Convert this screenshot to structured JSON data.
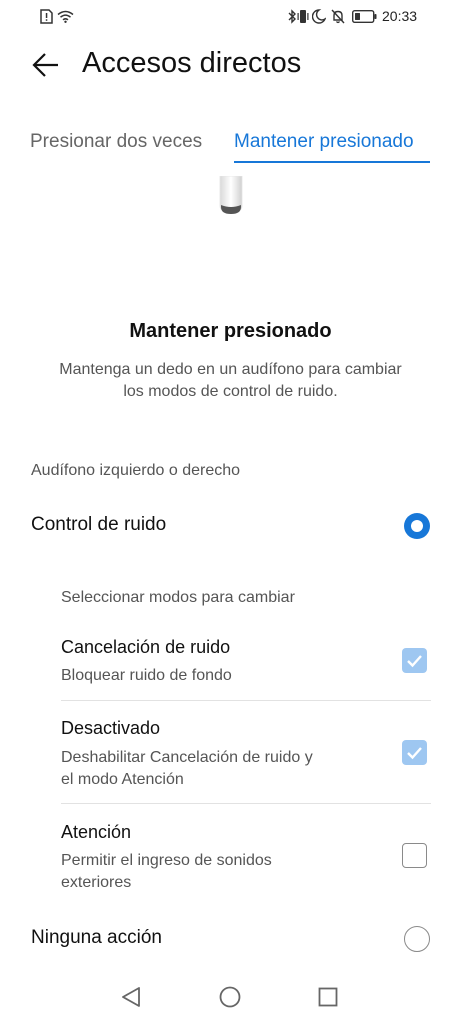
{
  "status_bar": {
    "time": "20:33",
    "icons": [
      "sim-alert-icon",
      "wifi-icon",
      "bluetooth-icon",
      "vibrate-icon",
      "moon-icon",
      "mute-icon",
      "battery-icon"
    ]
  },
  "header": {
    "title": "Accesos directos",
    "back_icon": "arrow-left-icon"
  },
  "tabs": [
    {
      "label": "Presionar dos veces",
      "active": false
    },
    {
      "label": "Mantener presionado",
      "active": true
    }
  ],
  "gesture": {
    "title": "Mantener presionado",
    "description_line1": "Mantenga un dedo en un audífono para cambiar",
    "description_line2": "los modos de control de ruido."
  },
  "earbud_section": {
    "label": "Audífono izquierdo o derecho"
  },
  "options": {
    "noise_control": {
      "label": "Control de ruido",
      "selected": true
    },
    "no_action": {
      "label": "Ninguna acción",
      "selected": false
    }
  },
  "modes": {
    "label": "Seleccionar modos para cambiar",
    "items": [
      {
        "title": "Cancelación de ruido",
        "subtitle_line1": "Bloquear ruido de fondo",
        "subtitle_line2": "",
        "checked": true
      },
      {
        "title": "Desactivado",
        "subtitle_line1": "Deshabilitar Cancelación de ruido y",
        "subtitle_line2": "el modo Atención",
        "checked": true
      },
      {
        "title": "Atención",
        "subtitle_line1": "Permitir el ingreso de sonidos",
        "subtitle_line2": "exteriores",
        "checked": false
      }
    ]
  },
  "colors": {
    "accent": "#1777d8",
    "checkbox_checked": "#9ec7f1",
    "text_primary": "#111111",
    "text_secondary": "#555555"
  },
  "nav_bar": {
    "icons": [
      "back-triangle-icon",
      "home-circle-icon",
      "recents-square-icon"
    ]
  }
}
